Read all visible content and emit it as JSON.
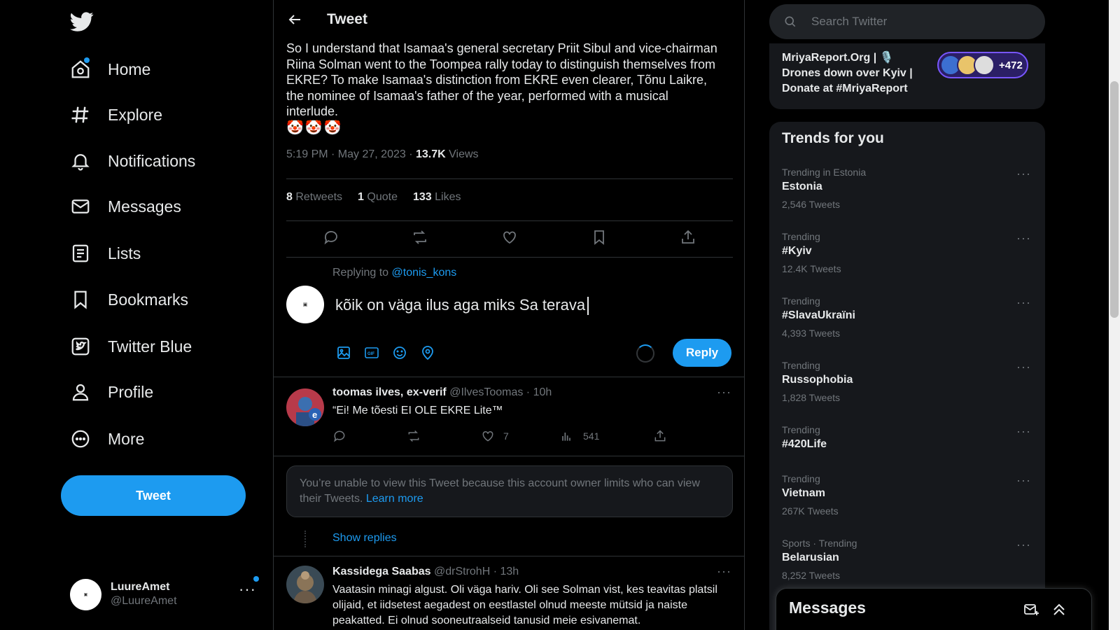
{
  "nav": {
    "items": [
      {
        "label": "Home",
        "icon": "home-icon"
      },
      {
        "label": "Explore",
        "icon": "hashtag-icon"
      },
      {
        "label": "Notifications",
        "icon": "bell-icon"
      },
      {
        "label": "Messages",
        "icon": "envelope-icon"
      },
      {
        "label": "Lists",
        "icon": "list-icon"
      },
      {
        "label": "Bookmarks",
        "icon": "bookmark-icon"
      },
      {
        "label": "Twitter Blue",
        "icon": "twitter-blue-icon"
      },
      {
        "label": "Profile",
        "icon": "person-icon"
      },
      {
        "label": "More",
        "icon": "more-circle-icon"
      }
    ],
    "tweet_button": "Tweet",
    "account": {
      "name": "LuureAmet",
      "handle": "@LuureAmet"
    }
  },
  "header": {
    "title": "Tweet"
  },
  "tweet": {
    "text": "So I understand that Isamaa's general secretary Priit Sibul and vice-chairman Riina Solman went to the Toompea rally today to distinguish themselves from EKRE? To make Isamaa's distinction from EKRE even clearer, Tõnu Laikre, the nominee of Isamaa's father of the year, performed with a musical interlude.",
    "emojis": "🤡🤡🤡",
    "time": "5:19 PM · May 27, 2023 · ",
    "views_count": "13.7K",
    "views_label": " Views",
    "retweets_count": "8",
    "retweets_label": " Retweets",
    "quotes_count": "1",
    "quotes_label": " Quote",
    "likes_count": "133",
    "likes_label": " Likes"
  },
  "compose": {
    "replying_to_label": "Replying to ",
    "replying_to_handle": "@tonis_kons",
    "text": "kõik on väga ilus aga miks Sa terava",
    "reply_button": "Reply"
  },
  "replies": [
    {
      "name": "toomas ilves, ex-verif",
      "handle": " @IlvesToomas · 10h",
      "text": "“Ei! Me tõesti EI OLE EKRE Lite™",
      "likes": "7",
      "views": "541"
    },
    {
      "name": "Kassidega Saabas",
      "handle": " @drStrohH · 13h",
      "text": "Vaatasin minagi algust. Oli väga hariv. Oli see Solman vist, kes teavitas platsil olijaid, et iidsetest aegadest on eestlastel olnud meeste mütsid ja naiste peakatted. Ei olnud sooneutraalseid tanusid meie esivanemat."
    }
  ],
  "limited_notice": {
    "text": "You’re unable to view this Tweet because this account owner limits who can view their Tweets. ",
    "link": "Learn more"
  },
  "show_replies": "Show replies",
  "search": {
    "placeholder": "Search Twitter"
  },
  "space": {
    "title": "MriyaReport.Org | 🎙️ Drones down over Kyiv | Donate at #MriyaReport",
    "count": "+472"
  },
  "trends": {
    "title": "Trends for you",
    "items": [
      {
        "context": "Trending in Estonia",
        "name": "Estonia",
        "count": "2,546 Tweets"
      },
      {
        "context": "Trending",
        "name": "#Kyiv",
        "count": "12.4K Tweets"
      },
      {
        "context": "Trending",
        "name": "#SlavaUkraïni",
        "count": "4,393 Tweets"
      },
      {
        "context": "Trending",
        "name": "Russophobia",
        "count": "1,828 Tweets"
      },
      {
        "context": "Trending",
        "name": "#420Life",
        "count": ""
      },
      {
        "context": "Trending",
        "name": "Vietnam",
        "count": "267K Tweets"
      },
      {
        "context": "Sports · Trending",
        "name": "Belarusian",
        "count": "8,252 Tweets"
      }
    ]
  },
  "messages_drawer": {
    "title": "Messages"
  },
  "colors": {
    "accent": "#1d9bf0",
    "background": "#000000",
    "card": "#16181c"
  }
}
